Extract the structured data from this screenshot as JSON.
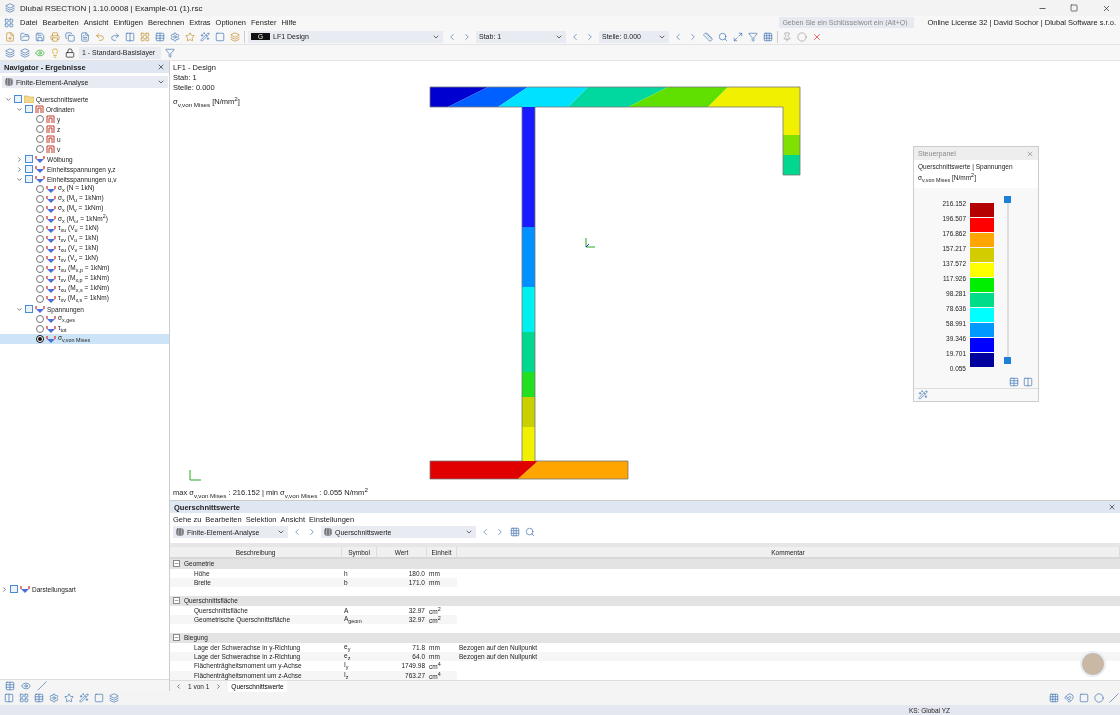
{
  "window": {
    "title": "Dlubal RSECTION | 1.10.0008 | Example-01 (1).rsc"
  },
  "menu": [
    "Datei",
    "Bearbeiten",
    "Ansicht",
    "Einfügen",
    "Berechnen",
    "Extras",
    "Optionen",
    "Fenster",
    "Hilfe"
  ],
  "search": {
    "placeholder": "Geben Sie ein Schlüsselwort ein (Alt+Q)"
  },
  "license": "Online License 32 | David Sochor | Dlubal Software s.r.o.",
  "toolbar": {
    "load_case_badge": "G",
    "load_case": "LF1  Design",
    "member": "Stab: 1",
    "location": "Stelle: 0.000",
    "layer": "1 - Standard-Basislayer"
  },
  "navigator": {
    "title": "Navigator - Ergebnisse",
    "analysis": "Finite-Element-Analyse",
    "tree": [
      {
        "label": "Querschnittswerte",
        "kind": "folder",
        "expanded": true,
        "checked": false,
        "children": [
          {
            "label": "Ordinaten",
            "kind": "ordinate",
            "expanded": true,
            "checked": false,
            "children": [
              {
                "label": "y",
                "kind": "ordinate",
                "selected": false
              },
              {
                "label": "z",
                "kind": "ordinate",
                "selected": false
              },
              {
                "label": "u",
                "kind": "ordinate",
                "selected": false
              },
              {
                "label": "v",
                "kind": "ordinate",
                "selected": false
              }
            ]
          },
          {
            "label": "Wölbung",
            "kind": "stress",
            "expanded": false,
            "checked": false
          },
          {
            "label": "Einheitsspannungen y,z",
            "kind": "stress",
            "expanded": false,
            "checked": false
          },
          {
            "label": "Einheitsspannungen u,v",
            "kind": "stress",
            "expanded": true,
            "checked": false,
            "children": [
              {
                "label": "σ$_{x}$ (N = 1kN)",
                "kind": "stress",
                "selected": false
              },
              {
                "label": "σ$_{x}$ (M$_{u}$ = 1kNm)",
                "kind": "stress",
                "selected": false
              },
              {
                "label": "σ$_{x}$ (M$_{v}$ = 1kNm)",
                "kind": "stress",
                "selected": false
              },
              {
                "label": "σ$_{x}$ (M$_{ω}$ = 1kNm$^{2}$)",
                "kind": "stress",
                "selected": false
              },
              {
                "label": "τ$_{xu}$ (V$_{u}$ = 1kN)",
                "kind": "stress",
                "selected": false
              },
              {
                "label": "τ$_{xv}$ (V$_{u}$ = 1kN)",
                "kind": "stress",
                "selected": false
              },
              {
                "label": "τ$_{xu}$ (V$_{v}$ = 1kN)",
                "kind": "stress",
                "selected": false
              },
              {
                "label": "τ$_{xv}$ (V$_{v}$ = 1kN)",
                "kind": "stress",
                "selected": false
              },
              {
                "label": "τ$_{xu}$ (M$_{x,p}$ = 1kNm)",
                "kind": "stress",
                "selected": false
              },
              {
                "label": "τ$_{xv}$ (M$_{x,p}$ = 1kNm)",
                "kind": "stress",
                "selected": false
              },
              {
                "label": "τ$_{xu}$ (M$_{x,s}$ = 1kNm)",
                "kind": "stress",
                "selected": false
              },
              {
                "label": "τ$_{xv}$ (M$_{x,s}$ = 1kNm)",
                "kind": "stress",
                "selected": false
              }
            ]
          },
          {
            "label": "Spannungen",
            "kind": "stress",
            "expanded": true,
            "checked": false,
            "children": [
              {
                "label": "σ$_{x,ges}$",
                "kind": "stress",
                "selected": false
              },
              {
                "label": "τ$_{tot}$",
                "kind": "stress",
                "selected": false
              },
              {
                "label": "σ$_{v,von Mises}$",
                "kind": "stress",
                "selected": true
              }
            ]
          }
        ]
      }
    ],
    "display_node": {
      "label": "Darstellungsart",
      "expanded": false,
      "checked": false
    }
  },
  "viewport": {
    "info": [
      "LF1 - Design",
      "Stab: 1",
      "Stelle: 0.000"
    ],
    "result_label": "σ$_{v,von Mises}$ [N/mm$^{2}$]",
    "summary": "max σ$_{v,von Mises}$ : 216.152 | min σ$_{v,von Mises}$ : 0.055 N/mm$^{2}$"
  },
  "control_panel": {
    "title": "Steuerpanel",
    "subtitle": "Querschnittswerte | Spannungen",
    "unit": "σ$_{v,von Mises}$ [N/mm$^{2}$]",
    "values": [
      "216.152",
      "196.507",
      "176.862",
      "157.217",
      "137.572",
      "117.926",
      "98.281",
      "78.636",
      "58.991",
      "39.346",
      "19.701",
      "0.055"
    ],
    "bands": [
      {
        "color": "#b40000"
      },
      {
        "color": "#ff0000"
      },
      {
        "color": "#ffa500"
      },
      {
        "color": "#d2cc00"
      },
      {
        "color": "#ffff00"
      },
      {
        "color": "#00ee00"
      },
      {
        "color": "#00dd88"
      },
      {
        "color": "#00ffff"
      },
      {
        "color": "#0099ff"
      },
      {
        "color": "#0000ff"
      },
      {
        "color": "#00009e"
      }
    ]
  },
  "results_panel": {
    "title": "Querschnittswerte",
    "menu": [
      "Gehe zu",
      "Bearbeiten",
      "Selektion",
      "Ansicht",
      "Einstellungen"
    ],
    "analysis": "Finite-Element-Analyse",
    "table_select": "Querschnittswerte",
    "columns": [
      "Beschreibung",
      "Symbol",
      "Wert",
      "Einheit",
      "Kommentar"
    ],
    "groups": [
      {
        "label": "Geometrie",
        "expanded": true,
        "rows": [
          {
            "description": "Höhe",
            "symbol": "h",
            "value": "180.0",
            "unit": "mm"
          },
          {
            "description": "Breite",
            "symbol": "b",
            "value": "171.0",
            "unit": "mm"
          }
        ]
      },
      {
        "label": "Querschnittsfläche",
        "expanded": true,
        "rows": [
          {
            "description": "Querschnittsfläche",
            "symbol": "A",
            "value": "32.97",
            "unit": "cm$^{2}$"
          },
          {
            "description": "Geometrische Querschnittsfläche",
            "symbol": "A$_{geom}$",
            "value": "32.97",
            "unit": "cm$^{2}$"
          }
        ]
      },
      {
        "label": "Biegung",
        "expanded": true,
        "rows": [
          {
            "description": "Lage der Schwerachse in y-Richtung",
            "symbol": "e$_{y}$",
            "value": "71.8",
            "unit": "mm",
            "comment": "Bezogen auf den Nullpunkt"
          },
          {
            "description": "Lage der Schwerachse in z-Richtung",
            "symbol": "e$_{z}$",
            "value": "64.0",
            "unit": "mm",
            "comment": "Bezogen auf den Nullpunkt"
          },
          {
            "description": "Flächenträgheitsmoment um y-Achse",
            "symbol": "I$_{y}$",
            "value": "1749.98",
            "unit": "cm$^{4}$"
          },
          {
            "description": "Flächenträgheitsmoment um z-Achse",
            "symbol": "I$_{z}$",
            "value": "763.27",
            "unit": "cm$^{4}$"
          }
        ]
      }
    ],
    "pager": "1 von 1",
    "tabs": [
      {
        "label": "Querschnittswerte",
        "selected": true
      }
    ]
  },
  "status_bar": {
    "coordinate_system": "KS: Global YZ"
  }
}
